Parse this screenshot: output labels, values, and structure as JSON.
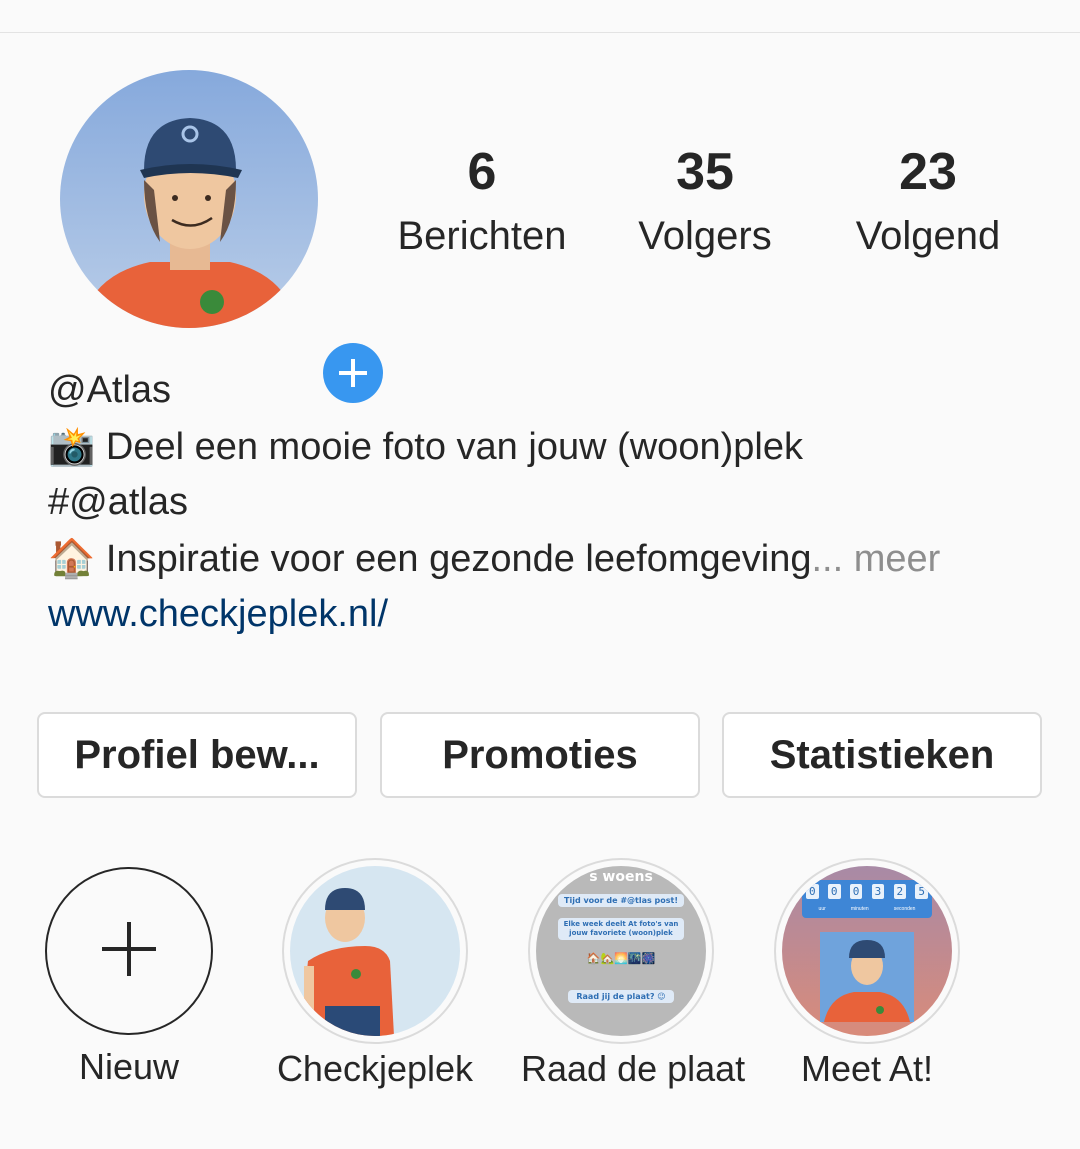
{
  "profile": {
    "stats": [
      {
        "value": "6",
        "label": "Berichten"
      },
      {
        "value": "35",
        "label": "Volgers"
      },
      {
        "value": "23",
        "label": "Volgend"
      }
    ],
    "bio": {
      "username": "@Atlas",
      "line1_emoji": "📸",
      "line1_text": " Deel een mooie foto van jouw (woon)plek",
      "line2_text": "#@atlas",
      "line3_emoji": "🏠",
      "line3_text": " Inspiratie voor een gezonde leefomgeving",
      "line3_ellipsis": "...",
      "more_label": " meer",
      "website": "www.checkjeplek.nl/"
    }
  },
  "actions": {
    "edit_profile": "Profiel bew...",
    "promotions": "Promoties",
    "insights": "Statistieken"
  },
  "highlights": [
    {
      "label": "Nieuw"
    },
    {
      "label": "Checkjeplek"
    },
    {
      "label": "Raad de plaat"
    },
    {
      "label": "Meet At!"
    }
  ],
  "highlight_raad": {
    "top_text": "s woens",
    "line1": "Tijd voor de #@tlas post!",
    "line2": "Elke week deelt At foto's van jouw favoriete (woon)plek",
    "emoji_row": "🏠🏡🌅🌃🎆",
    "line3": "Raad jij de plaat? 😉"
  },
  "highlight_meet": {
    "countdown": [
      "0",
      "0",
      "0",
      "3",
      "2",
      "5"
    ],
    "units": [
      "uur",
      "minuten",
      "seconden"
    ]
  },
  "colors": {
    "accent_blue": "#3897f0",
    "link_blue": "#003569",
    "muted": "#8e8e8e",
    "shirt_orange": "#e8623a",
    "sky_blue": "#8fb3e2"
  }
}
